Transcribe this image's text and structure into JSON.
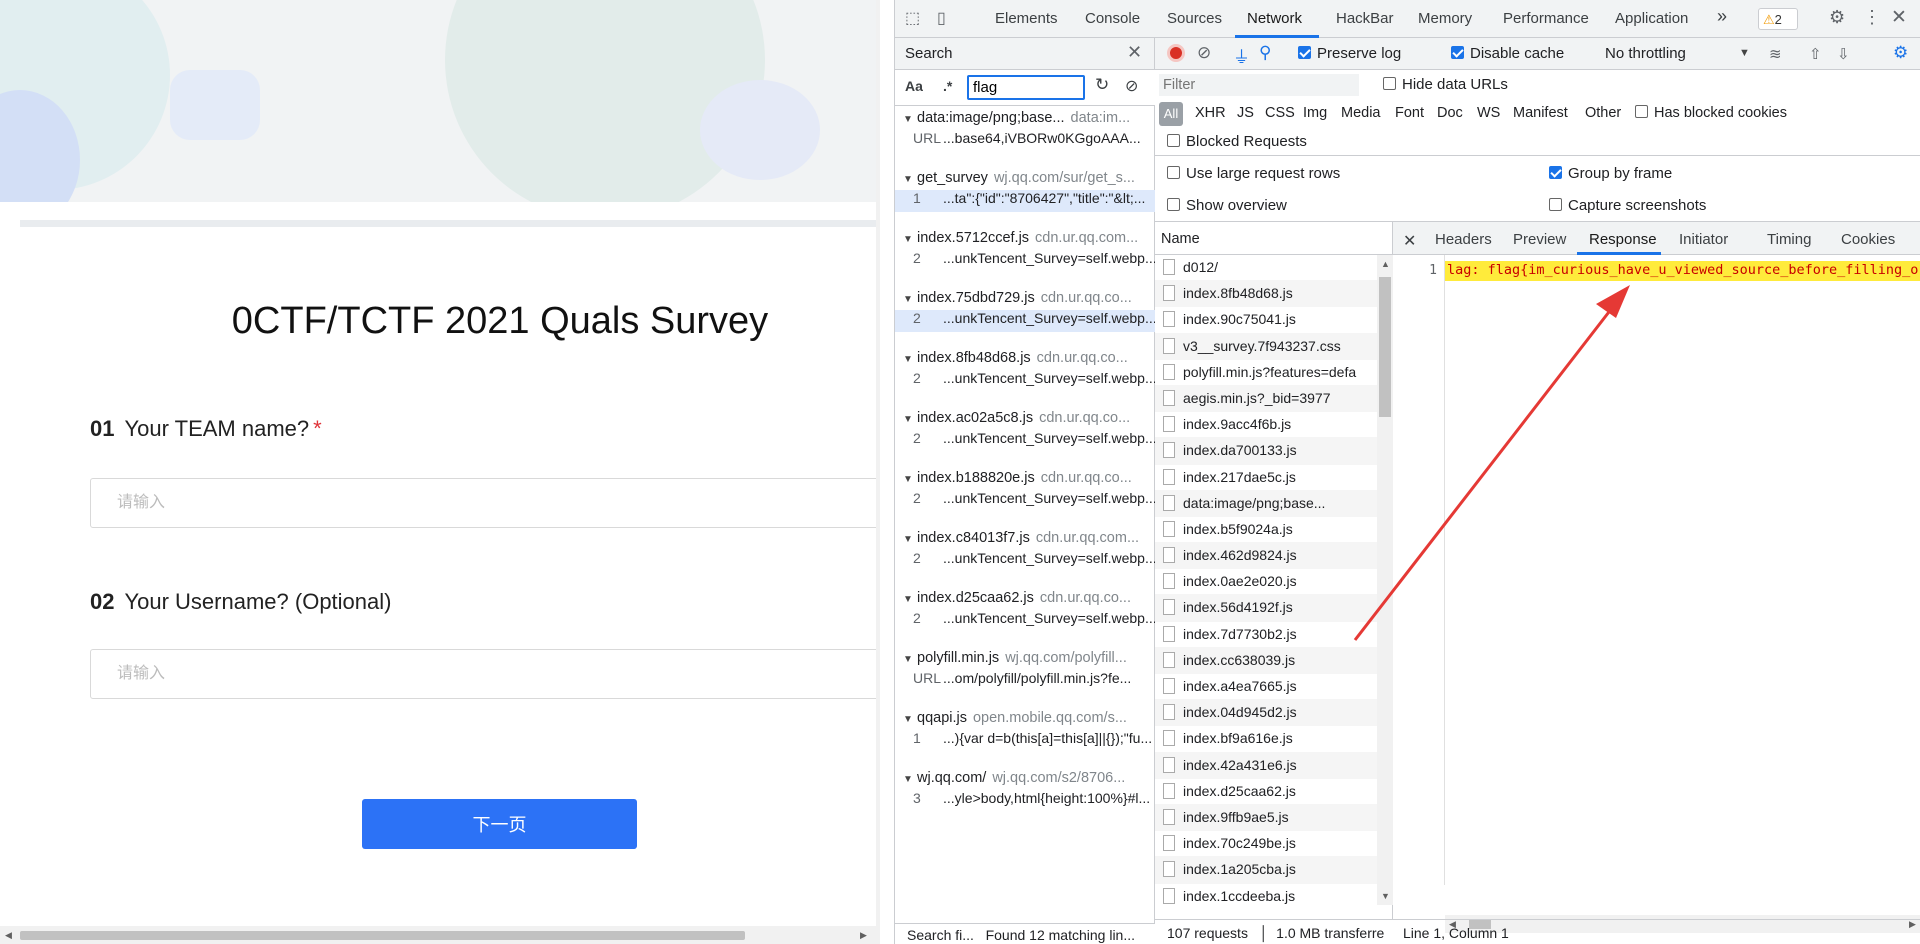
{
  "survey": {
    "title": "0CTF/TCTF 2021 Quals Survey",
    "questions": [
      {
        "number": "01",
        "text": "Your TEAM name?",
        "required_mark": "*",
        "placeholder": "请输入"
      },
      {
        "number": "02",
        "text": "Your Username? (Optional)",
        "placeholder": "请输入"
      }
    ],
    "next_label": "下一页"
  },
  "devtools": {
    "tabs": [
      "Elements",
      "Console",
      "Sources",
      "Network",
      "HackBar",
      "Memory",
      "Performance",
      "Application"
    ],
    "active_tab": "Network",
    "more_tabs": "»",
    "warning_count": "2",
    "search": {
      "label": "Search",
      "query": "flag",
      "case_label": "Aa",
      "regex_label": ".*",
      "results": [
        {
          "file": "data:image/png;base...",
          "url": "data:im...",
          "line": "URL",
          "text": "...base64,iVBORw0KGgoAAA..."
        },
        {
          "file": "get_survey",
          "url": "wj.qq.com/sur/get_s...",
          "line": "1",
          "text": "...ta\":{\"id\":\"8706427\",\"title\":\"&lt;...",
          "selected": true
        },
        {
          "file": "index.5712ccef.js",
          "url": "cdn.ur.qq.com...",
          "line": "2",
          "text": "...unkTencent_Survey=self.webp..."
        },
        {
          "file": "index.75dbd729.js",
          "url": "cdn.ur.qq.co...",
          "line": "2",
          "text": "...unkTencent_Survey=self.webp...",
          "selected": true
        },
        {
          "file": "index.8fb48d68.js",
          "url": "cdn.ur.qq.co...",
          "line": "2",
          "text": "...unkTencent_Survey=self.webp..."
        },
        {
          "file": "index.ac02a5c8.js",
          "url": "cdn.ur.qq.co...",
          "line": "2",
          "text": "...unkTencent_Survey=self.webp..."
        },
        {
          "file": "index.b188820e.js",
          "url": "cdn.ur.qq.co...",
          "line": "2",
          "text": "...unkTencent_Survey=self.webp..."
        },
        {
          "file": "index.c84013f7.js",
          "url": "cdn.ur.qq.com...",
          "line": "2",
          "text": "...unkTencent_Survey=self.webp..."
        },
        {
          "file": "index.d25caa62.js",
          "url": "cdn.ur.qq.co...",
          "line": "2",
          "text": "...unkTencent_Survey=self.webp..."
        },
        {
          "file": "polyfill.min.js",
          "url": "wj.qq.com/polyfill...",
          "line": "URL",
          "text": "...om/polyfill/polyfill.min.js?fe..."
        },
        {
          "file": "qqapi.js",
          "url": "open.mobile.qq.com/s...",
          "line": "1",
          "text": "...){var d=b(this[a]=this[a]||{});\"fu..."
        },
        {
          "file": "wj.qq.com/",
          "url": "wj.qq.com/s2/8706...",
          "line": "3",
          "text": "...yle>body,html{height:100%}#l..."
        }
      ],
      "footer_left": "Search fi...",
      "footer_right": "Found 12 matching lin..."
    },
    "network": {
      "preserve_log": "Preserve log",
      "disable_cache": "Disable cache",
      "throttling": "No throttling",
      "filter_placeholder": "Filter",
      "hide_data_urls": "Hide data URLs",
      "types": [
        "All",
        "XHR",
        "JS",
        "CSS",
        "Img",
        "Media",
        "Font",
        "Doc",
        "WS",
        "Manifest",
        "Other"
      ],
      "has_blocked_cookies": "Has blocked cookies",
      "blocked_requests": "Blocked Requests",
      "large_rows": "Use large request rows",
      "group_by_frame": "Group by frame",
      "show_overview": "Show overview",
      "capture_screenshots": "Capture screenshots",
      "name_header": "Name",
      "requests": [
        "d012/",
        "index.8fb48d68.js",
        "index.90c75041.js",
        "v3__survey.7f943237.css",
        "polyfill.min.js?features=defa",
        "aegis.min.js?_bid=3977",
        "index.9acc4f6b.js",
        "index.da700133.js",
        "index.217dae5c.js",
        "data:image/png;base...",
        "index.b5f9024a.js",
        "index.462d9824.js",
        "index.0ae2e020.js",
        "index.56d4192f.js",
        "index.7d7730b2.js",
        "index.cc638039.js",
        "index.a4ea7665.js",
        "index.04d945d2.js",
        "index.bf9a616e.js",
        "index.42a431e6.js",
        "index.d25caa62.js",
        "index.9ffb9ae5.js",
        "index.70c249be.js",
        "index.1a205cba.js",
        "index.1ccdeeba.js"
      ],
      "summary_requests": "107 requests",
      "summary_transferred": "1.0 MB transferre",
      "detail_tabs": [
        "Headers",
        "Preview",
        "Response",
        "Initiator",
        "Timing",
        "Cookies"
      ],
      "active_detail_tab": "Response",
      "response_line_number": "1",
      "response_text": "lag: flag{im_curious_have_u_viewed_source_before_filling_o",
      "cursor_position": "Line 1, Column 1"
    }
  },
  "colors": {
    "accent": "#1a73e8",
    "button": "#2c72f6",
    "highlight": "#ffeb3b",
    "arrow": "#e53935"
  }
}
